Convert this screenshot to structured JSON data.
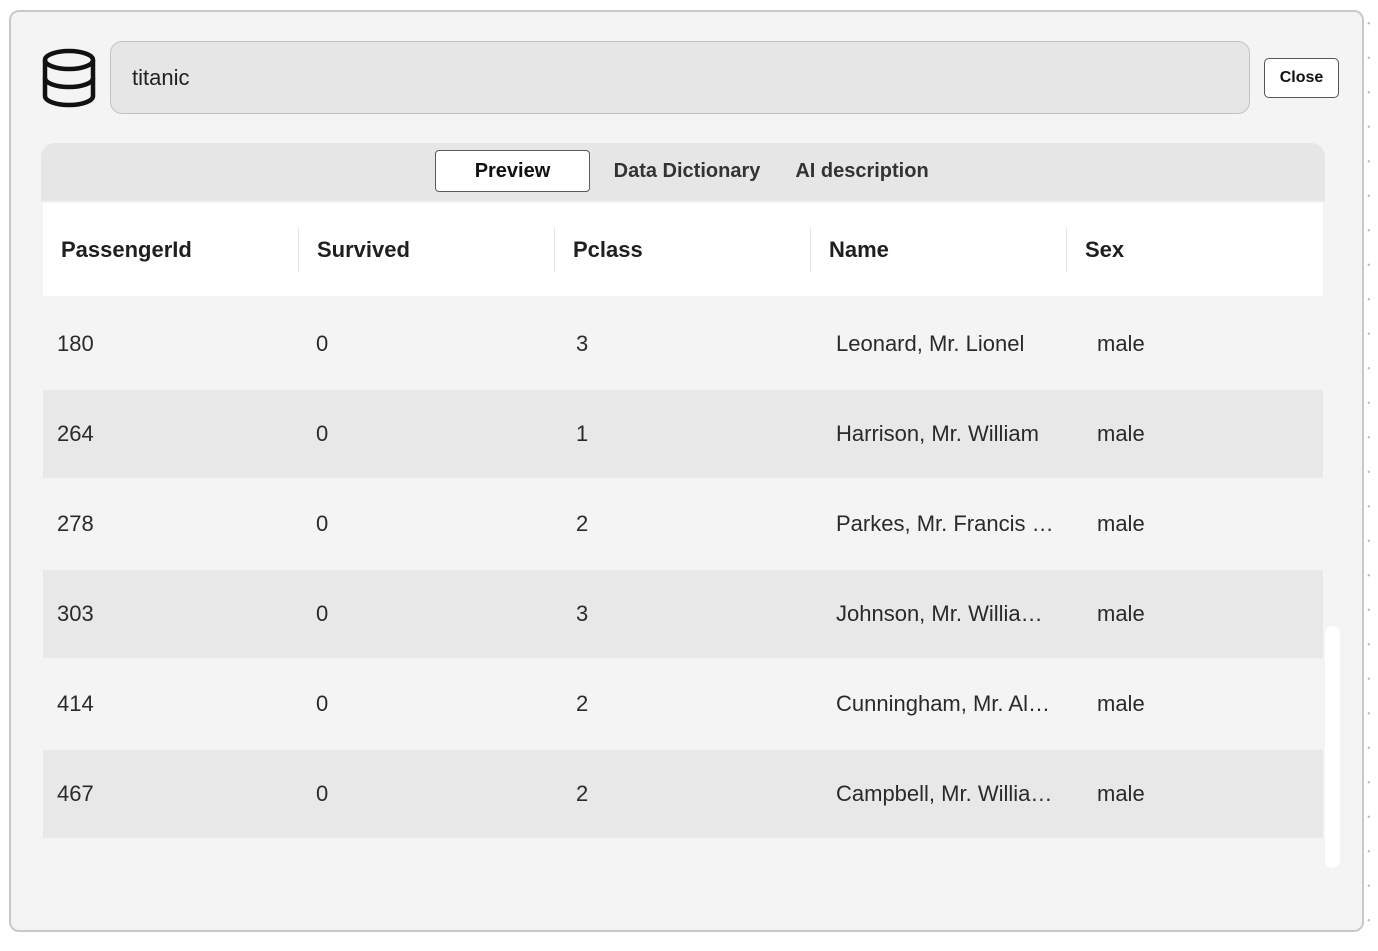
{
  "dataset": {
    "name": "titanic",
    "icon": "database-icon"
  },
  "close_label": "Close",
  "tabs": [
    {
      "label": "Preview",
      "active": true
    },
    {
      "label": "Data Dictionary",
      "active": false
    },
    {
      "label": "AI description",
      "active": false
    }
  ],
  "table": {
    "columns": [
      "PassengerId",
      "Survived",
      "Pclass",
      "Name",
      "Sex"
    ],
    "rows": [
      [
        "180",
        "0",
        "3",
        "Leonard, Mr. Lionel",
        "male"
      ],
      [
        "264",
        "0",
        "1",
        "Harrison, Mr. William",
        "male"
      ],
      [
        "278",
        "0",
        "2",
        "Parkes, Mr. Francis …",
        "male"
      ],
      [
        "303",
        "0",
        "3",
        "Johnson, Mr. Willia…",
        "male"
      ],
      [
        "414",
        "0",
        "2",
        "Cunningham, Mr. Al…",
        "male"
      ],
      [
        "467",
        "0",
        "2",
        "Campbell, Mr. Willia…",
        "male"
      ]
    ]
  },
  "colors": {
    "dialog_bg": "#f4f4f4",
    "row_alt": "#e8e8e8",
    "tab_bar": "#e6e6e6"
  }
}
